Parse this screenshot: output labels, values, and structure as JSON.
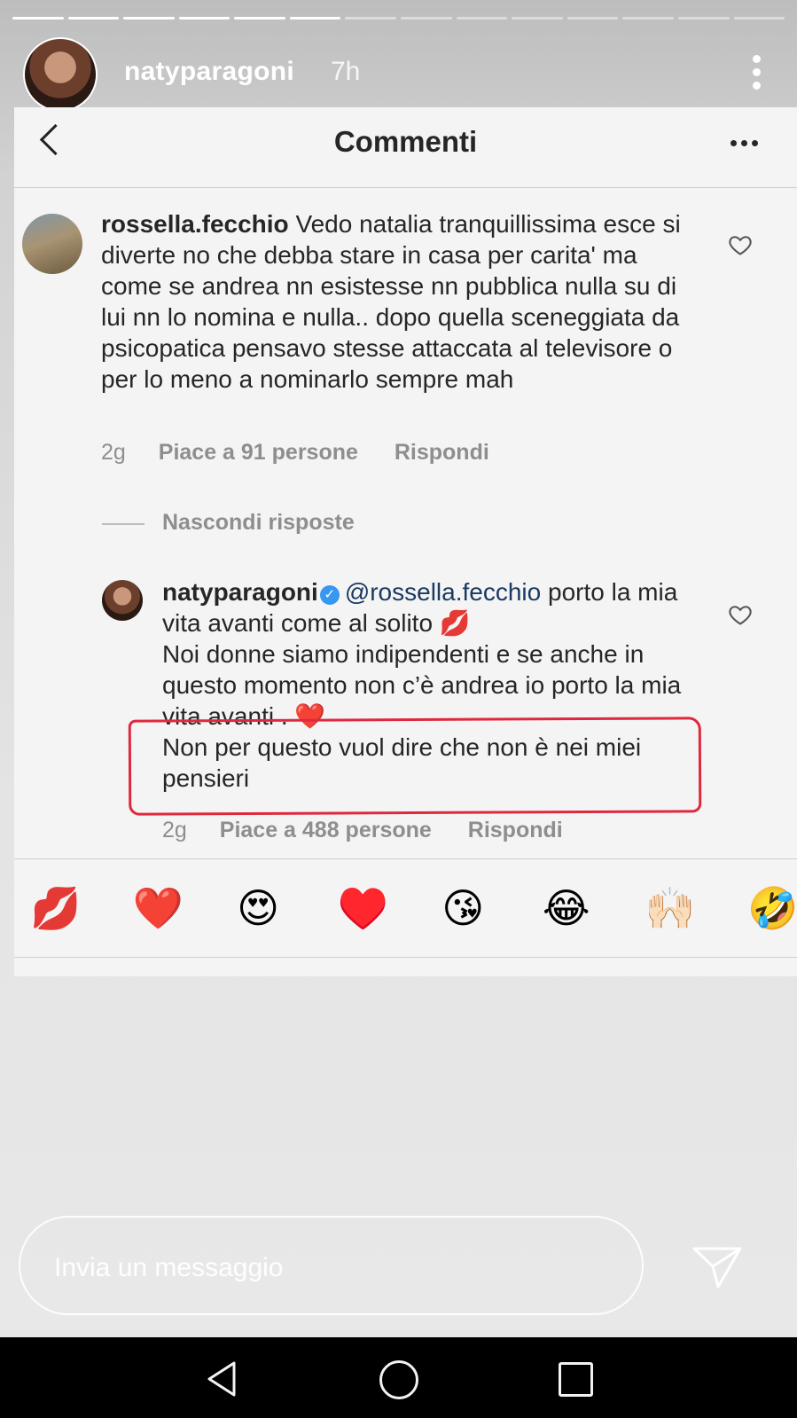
{
  "story": {
    "progress_total": 14,
    "progress_done": 6,
    "username": "natyparagoni",
    "time": "7h"
  },
  "card": {
    "title": "Commenti",
    "comments": [
      {
        "username": "rossella.fecchio",
        "text": "Vedo natalia tranquillissima esce si diverte no che debba stare in casa per carita' ma come se andrea nn esistesse nn pubblica nulla su di lui nn lo nomina e nulla.. dopo quella sceneggiata da psicopatica pensavo stesse attaccata al televisore o per lo meno a nominarlo sempre mah",
        "time": "2g",
        "likes": "Piace a 91 persone",
        "reply_label": "Rispondi"
      }
    ],
    "hide_replies": "Nascondi risposte",
    "reply": {
      "username": "natyparagoni",
      "mention": "@rossella.fecchio",
      "line1": "porto la mia vita avanti come al solito 💋",
      "line2": "Noi donne siamo indipendenti e se anche in questo momento non c’è andrea io porto la mia vita avanti . ❤️",
      "line3": "Non per questo vuol dire che non è nei miei pensieri",
      "time": "2g",
      "likes": "Piace a 488 persone",
      "reply_label": "Rispondi"
    },
    "emojis": [
      "💋",
      "❤️",
      "😍",
      "♥️",
      "😘",
      "😂",
      "🙌🏻",
      "🤣"
    ]
  },
  "message_input": {
    "placeholder": "Invia un messaggio"
  },
  "colors": {
    "highlight": "#e0283d",
    "verified": "#3897f0",
    "mention": "#1a3a63"
  }
}
